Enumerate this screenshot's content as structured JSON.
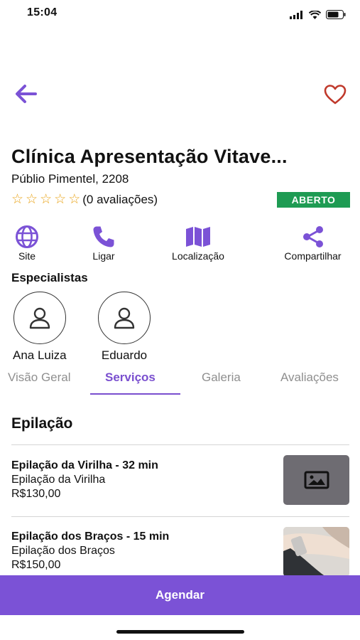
{
  "status_bar": {
    "time": "15:04"
  },
  "clinic": {
    "name": "Clínica Apresentação Vitave...",
    "address": "Públio Pimentel, 2208",
    "rating_stars": 0,
    "reviews_text": "(0 avaliações)",
    "open_status": "ABERTO"
  },
  "colors": {
    "accent": "#7b52d6",
    "open_badge": "#1e9b53",
    "star": "#e9a41a",
    "heart": "#c0392b"
  },
  "actions": [
    {
      "label": "Site",
      "icon": "globe-icon"
    },
    {
      "label": "Ligar",
      "icon": "phone-icon"
    },
    {
      "label": "Localização",
      "icon": "map-icon"
    },
    {
      "label": "Compartilhar",
      "icon": "share-icon"
    }
  ],
  "specialists": {
    "title": "Especialistas",
    "items": [
      {
        "name": "Ana Luiza"
      },
      {
        "name": "Eduardo"
      }
    ]
  },
  "tabs": [
    {
      "label": "Visão Geral",
      "active": false
    },
    {
      "label": "Serviços",
      "active": true
    },
    {
      "label": "Galeria",
      "active": false
    },
    {
      "label": "Avaliações",
      "active": false
    }
  ],
  "services": {
    "section_title": "Epilação",
    "items": [
      {
        "name": "Epilação da Virilha - 32 min",
        "description": "Epilação da Virilha",
        "price": "R$130,00",
        "thumb": "image-placeholder-icon"
      },
      {
        "name": "Epilação dos Braços - 15 min",
        "description": "Epilação dos Braços",
        "price": "R$150,00",
        "thumb": "arm-photo"
      }
    ]
  },
  "cta": {
    "label": "Agendar"
  }
}
